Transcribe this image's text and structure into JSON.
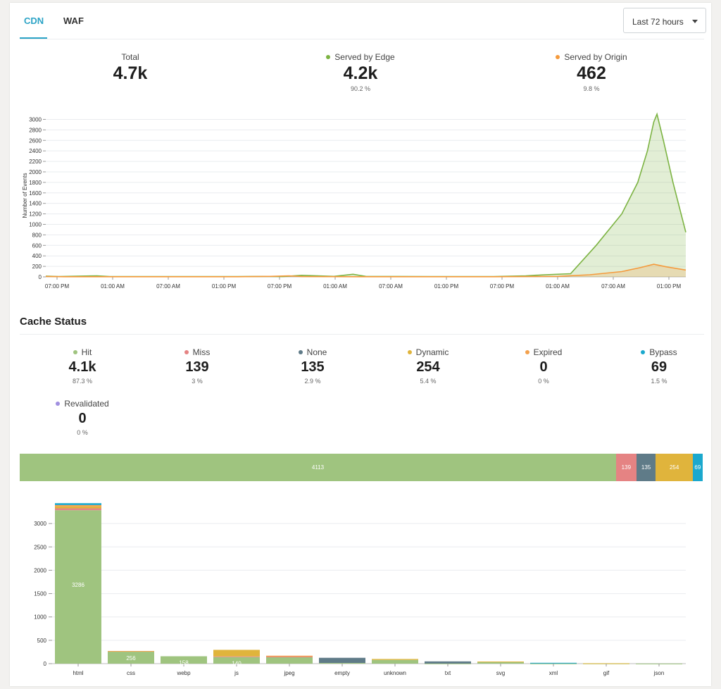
{
  "tabs": [
    {
      "label": "CDN",
      "active": true
    },
    {
      "label": "WAF",
      "active": false
    }
  ],
  "time_range": {
    "selected": "Last 72 hours",
    "icon": "caret-down-icon"
  },
  "summary": {
    "total": {
      "label": "Total",
      "value": "4.7k"
    },
    "edge": {
      "label": "Served by Edge",
      "value": "4.2k",
      "percent": "90.2 %",
      "color": "#7cb342"
    },
    "origin": {
      "label": "Served by Origin",
      "value": "462",
      "percent": "9.8 %",
      "color": "#f59a3c"
    }
  },
  "cache_status": {
    "title": "Cache Status",
    "items": [
      {
        "label": "Hit",
        "value": "4.1k",
        "percent": "87.3 %",
        "color": "#9fc47f"
      },
      {
        "label": "Miss",
        "value": "139",
        "percent": "3 %",
        "color": "#e58383"
      },
      {
        "label": "None",
        "value": "135",
        "percent": "2.9 %",
        "color": "#5f7b88"
      },
      {
        "label": "Dynamic",
        "value": "254",
        "percent": "5.4 %",
        "color": "#e0b43c"
      },
      {
        "label": "Expired",
        "value": "0",
        "percent": "0 %",
        "color": "#f3a14d"
      },
      {
        "label": "Bypass",
        "value": "69",
        "percent": "1.5 %",
        "color": "#1ba8cd"
      },
      {
        "label": "Revalidated",
        "value": "0",
        "percent": "0 %",
        "color": "#a08fe0"
      }
    ]
  },
  "stacked_bar": {
    "segments": [
      {
        "name": "Hit",
        "value": 4113,
        "label": "4113",
        "color": "#9fc47f"
      },
      {
        "name": "Miss",
        "value": 139,
        "label": "139",
        "color": "#e58383"
      },
      {
        "name": "None",
        "value": 135,
        "label": "135",
        "color": "#5f7b88"
      },
      {
        "name": "Dynamic",
        "value": 254,
        "label": "254",
        "color": "#e0b43c"
      },
      {
        "name": "Bypass",
        "value": 69,
        "label": "69",
        "color": "#1ba8cd"
      }
    ]
  },
  "chart_data": [
    {
      "type": "area",
      "ylabel": "Number of Events",
      "ylim": [
        0,
        3100
      ],
      "yticks": [
        0,
        200,
        400,
        600,
        800,
        1000,
        1200,
        1400,
        1600,
        1800,
        2000,
        2200,
        2400,
        2600,
        2800,
        3000
      ],
      "xticks": [
        "07:00 PM",
        "01:00 AM",
        "07:00 AM",
        "01:00 PM",
        "07:00 PM",
        "01:00 AM",
        "07:00 AM",
        "01:00 PM",
        "07:00 PM",
        "01:00 AM",
        "07:00 AM",
        "01:00 PM"
      ],
      "grid": true,
      "series": [
        {
          "name": "Served by Edge",
          "color": "#7cb342",
          "x": [
            0,
            0.02,
            0.08,
            0.1,
            0.13,
            0.2,
            0.3,
            0.34,
            0.37,
            0.4,
            0.45,
            0.48,
            0.5,
            0.6,
            0.7,
            0.75,
            0.78,
            0.82,
            0.86,
            0.9,
            0.925,
            0.94,
            0.95,
            0.955,
            0.965,
            0.98,
            1.0
          ],
          "y": [
            15,
            5,
            20,
            5,
            5,
            5,
            5,
            10,
            5,
            30,
            10,
            50,
            10,
            5,
            5,
            20,
            40,
            60,
            600,
            1200,
            1800,
            2400,
            2950,
            3100,
            2600,
            1800,
            850
          ]
        },
        {
          "name": "Served by Origin",
          "color": "#f59a3c",
          "x": [
            0,
            0.03,
            0.1,
            0.2,
            0.3,
            0.35,
            0.38,
            0.4,
            0.5,
            0.6,
            0.7,
            0.8,
            0.85,
            0.9,
            0.93,
            0.95,
            0.97,
            1.0
          ],
          "y": [
            8,
            3,
            3,
            3,
            3,
            10,
            20,
            5,
            3,
            3,
            3,
            10,
            40,
            100,
            180,
            240,
            190,
            130
          ]
        }
      ]
    },
    {
      "type": "bar",
      "ylim": [
        0,
        3500
      ],
      "yticks": [
        0,
        500,
        1000,
        1500,
        2000,
        2500,
        3000
      ],
      "categories": [
        "html",
        "css",
        "webp",
        "js",
        "jpeg",
        "empty",
        "unknown",
        "txt",
        "svg",
        "xml",
        "gif",
        "json"
      ],
      "grid": true,
      "series": [
        {
          "name": "Hit",
          "color": "#9fc47f",
          "values": [
            3286,
            256,
            158,
            140,
            140,
            15,
            80,
            3,
            30,
            3,
            3,
            1
          ]
        },
        {
          "name": "Miss",
          "color": "#e58383",
          "values": [
            40,
            0,
            0,
            15,
            10,
            0,
            0,
            0,
            0,
            0,
            0,
            0
          ]
        },
        {
          "name": "None",
          "color": "#5f7b88",
          "values": [
            0,
            0,
            0,
            0,
            0,
            110,
            0,
            45,
            0,
            0,
            0,
            0
          ]
        },
        {
          "name": "Dynamic",
          "color": "#e0b43c",
          "values": [
            40,
            0,
            0,
            140,
            0,
            0,
            20,
            0,
            15,
            0,
            5,
            0
          ]
        },
        {
          "name": "Expired",
          "color": "#f3a14d",
          "values": [
            30,
            15,
            0,
            0,
            20,
            0,
            0,
            0,
            0,
            0,
            0,
            0
          ]
        },
        {
          "name": "Bypass",
          "color": "#1ba8cd",
          "values": [
            40,
            0,
            0,
            0,
            0,
            0,
            0,
            0,
            0,
            15,
            0,
            0
          ]
        }
      ],
      "data_labels": [
        "3286",
        "256",
        "158",
        "140"
      ]
    }
  ]
}
